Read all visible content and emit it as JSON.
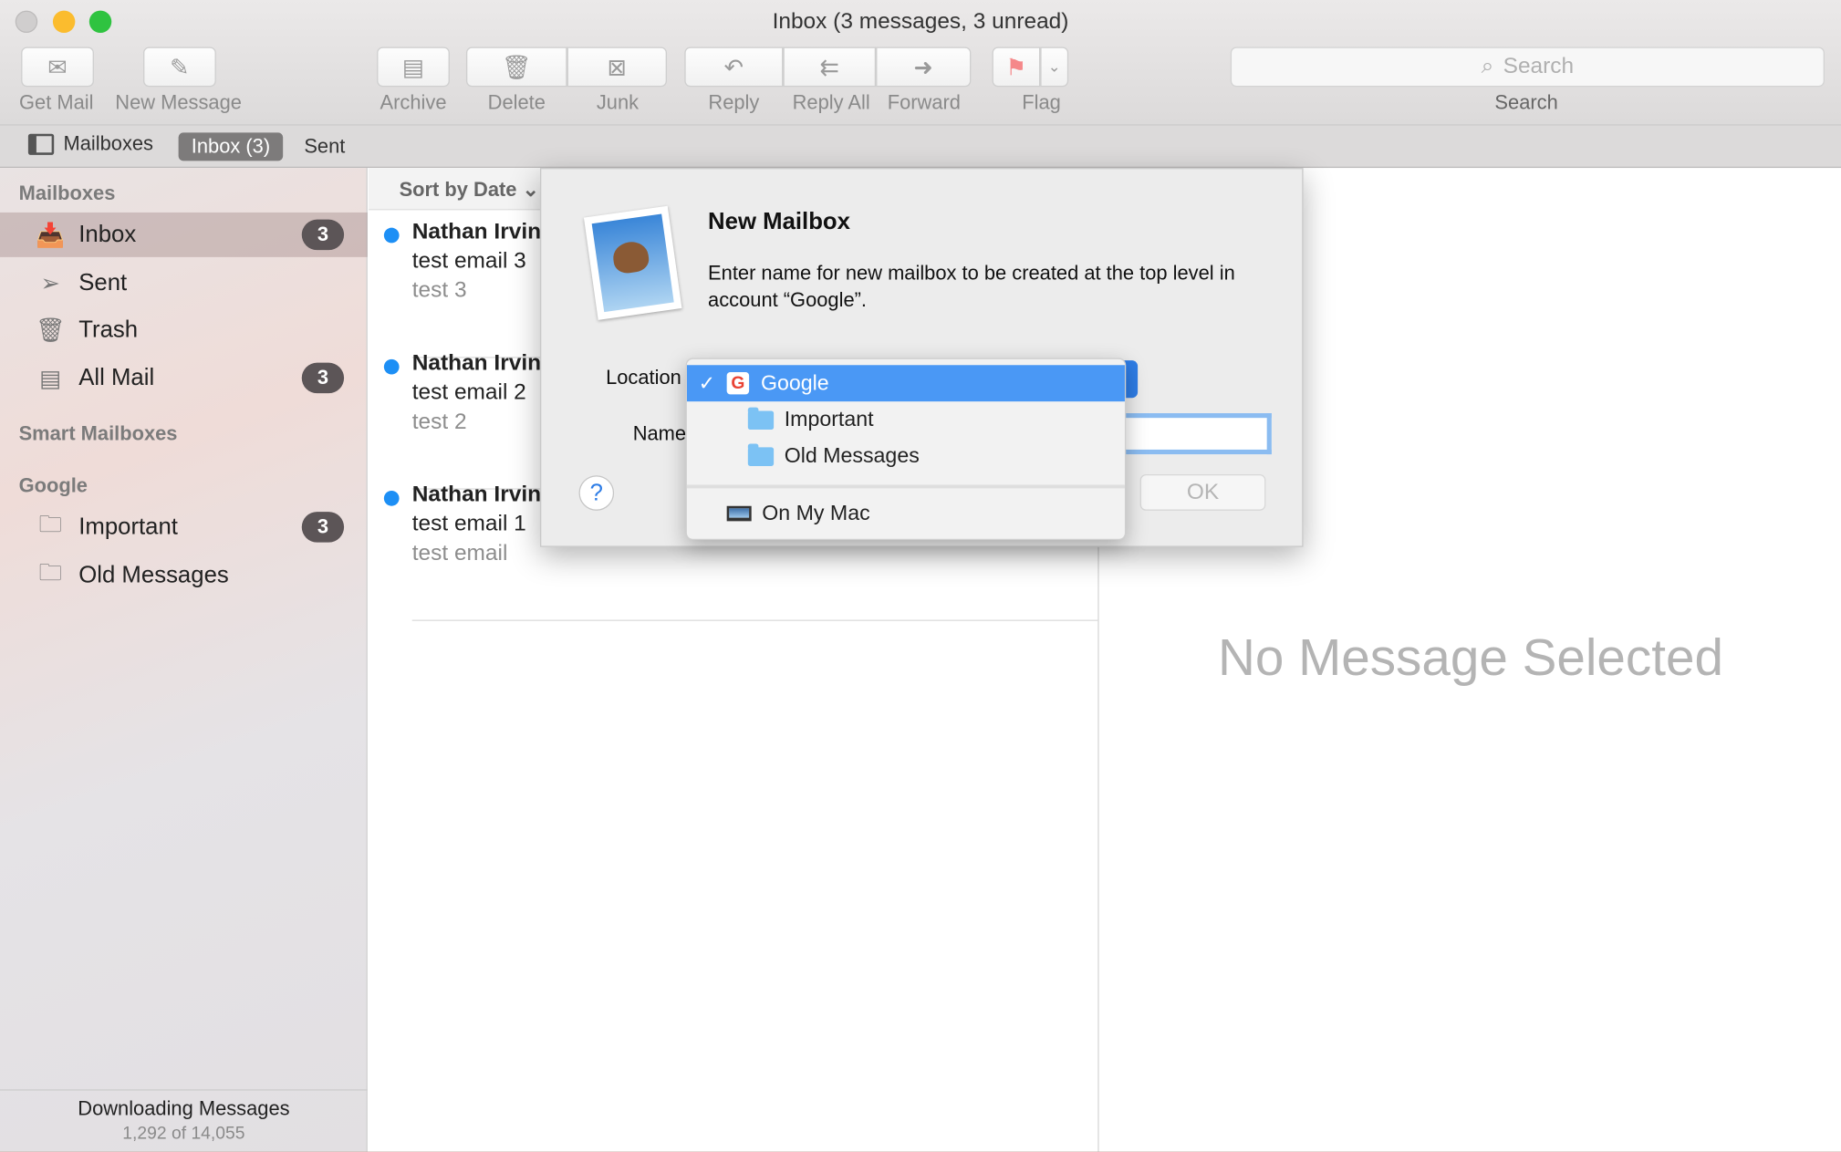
{
  "window": {
    "title": "Inbox (3 messages, 3 unread)"
  },
  "toolbar": {
    "get_mail": "Get Mail",
    "new_message": "New Message",
    "archive": "Archive",
    "delete": "Delete",
    "junk": "Junk",
    "reply": "Reply",
    "reply_all": "Reply All",
    "forward": "Forward",
    "flag": "Flag",
    "search_placeholder": "Search",
    "search_label": "Search"
  },
  "favorites": {
    "mailboxes": "Mailboxes",
    "inbox": "Inbox (3)",
    "sent": "Sent"
  },
  "sidebar": {
    "mailboxes_header": "Mailboxes",
    "items": [
      {
        "label": "Inbox",
        "badge": "3"
      },
      {
        "label": "Sent"
      },
      {
        "label": "Trash"
      },
      {
        "label": "All Mail",
        "badge": "3"
      }
    ],
    "smart_header": "Smart Mailboxes",
    "google_header": "Google",
    "google_items": [
      {
        "label": "Important",
        "badge": "3"
      },
      {
        "label": "Old Messages"
      }
    ],
    "footer_title": "Downloading Messages",
    "footer_progress": "1,292 of 14,055"
  },
  "list": {
    "sort": "Sort by Date",
    "messages": [
      {
        "from": "Nathan Irvin",
        "subject": "test email 3",
        "preview": "test 3"
      },
      {
        "from": "Nathan Irvin",
        "subject": "test email 2",
        "preview": "test 2"
      },
      {
        "from": "Nathan Irvin",
        "subject": "test email 1",
        "preview": "test email"
      }
    ]
  },
  "viewer": {
    "empty": "No Message Selected"
  },
  "dialog": {
    "title": "New Mailbox",
    "description": "Enter name for new mailbox to be created at the top level in account “Google”.",
    "location_label": "Location",
    "name_label": "Name",
    "name_value": "",
    "ok": "OK",
    "help": "?",
    "menu": {
      "selected": "Google",
      "children": [
        "Important",
        "Old Messages"
      ],
      "other": "On My Mac",
      "check": "✓"
    }
  },
  "colors": {
    "accent": "#4a98f5",
    "unread_dot": "#1d8ff5",
    "badge": "#5c5557"
  }
}
